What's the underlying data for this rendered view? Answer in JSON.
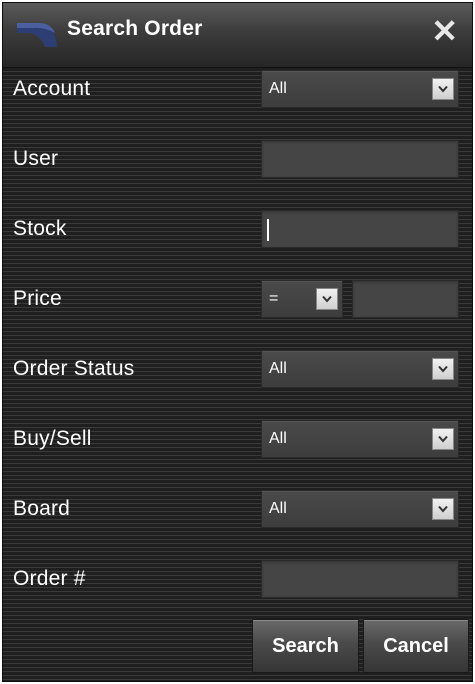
{
  "dialog": {
    "title": "Search Order",
    "close_glyph": "✕"
  },
  "fields": {
    "account": {
      "label": "Account",
      "value": "All"
    },
    "user": {
      "label": "User",
      "value": ""
    },
    "stock": {
      "label": "Stock",
      "value": ""
    },
    "price": {
      "label": "Price",
      "operator": "=",
      "value": ""
    },
    "order_status": {
      "label": "Order Status",
      "value": "All"
    },
    "buy_sell": {
      "label": "Buy/Sell",
      "value": "All"
    },
    "board": {
      "label": "Board",
      "value": "All"
    },
    "order_number": {
      "label": "Order #",
      "value": ""
    }
  },
  "buttons": {
    "search": "Search",
    "cancel": "Cancel"
  },
  "icons": {
    "logo": "brand-logo-icon",
    "close": "close-icon",
    "dropdown": "chevron-down-icon"
  },
  "colors": {
    "text": "#ffffff",
    "logo": "#2c3e73",
    "panel": "#2a2a2a"
  }
}
